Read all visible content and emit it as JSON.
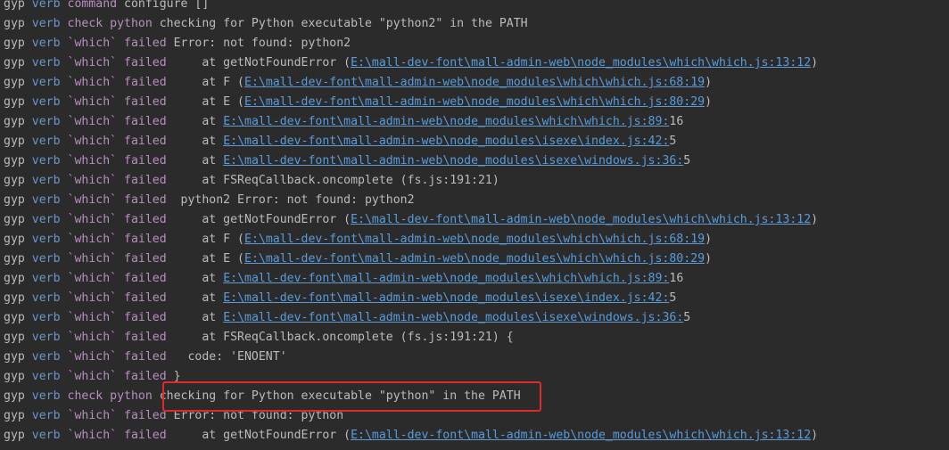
{
  "colors": {
    "background": "#2b2b2b",
    "text": "#bbbbbb",
    "level": "#6a97c8",
    "category": "#b78fbe",
    "link": "#5a9bd8",
    "highlight": "#e02a2a"
  },
  "lines": [
    {
      "tag": "gyp",
      "level": "verb",
      "category": "command",
      "pre": " configure []",
      "link": "",
      "post": ""
    },
    {
      "tag": "gyp",
      "level": "verb",
      "category": "check python",
      "pre": " checking for Python executable \"python2\" in the PATH",
      "link": "",
      "post": ""
    },
    {
      "tag": "gyp",
      "level": "verb",
      "category": "`which` failed",
      "pre": " Error: not found: python2",
      "link": "",
      "post": ""
    },
    {
      "tag": "gyp",
      "level": "verb",
      "category": "`which` failed",
      "pre": "     at getNotFoundError (",
      "link": "E:\\mall-dev-font\\mall-admin-web\\node_modules\\which\\which.js:13:12",
      "post": ")"
    },
    {
      "tag": "gyp",
      "level": "verb",
      "category": "`which` failed",
      "pre": "     at F (",
      "link": "E:\\mall-dev-font\\mall-admin-web\\node_modules\\which\\which.js:68:19",
      "post": ")"
    },
    {
      "tag": "gyp",
      "level": "verb",
      "category": "`which` failed",
      "pre": "     at E (",
      "link": "E:\\mall-dev-font\\mall-admin-web\\node_modules\\which\\which.js:80:29",
      "post": ")"
    },
    {
      "tag": "gyp",
      "level": "verb",
      "category": "`which` failed",
      "pre": "     at ",
      "link": "E:\\mall-dev-font\\mall-admin-web\\node_modules\\which\\which.js:89:",
      "post": "16"
    },
    {
      "tag": "gyp",
      "level": "verb",
      "category": "`which` failed",
      "pre": "     at ",
      "link": "E:\\mall-dev-font\\mall-admin-web\\node_modules\\isexe\\index.js:42:",
      "post": "5"
    },
    {
      "tag": "gyp",
      "level": "verb",
      "category": "`which` failed",
      "pre": "     at ",
      "link": "E:\\mall-dev-font\\mall-admin-web\\node_modules\\isexe\\windows.js:36:",
      "post": "5"
    },
    {
      "tag": "gyp",
      "level": "verb",
      "category": "`which` failed",
      "pre": "     at FSReqCallback.oncomplete (fs.js:191:21)",
      "link": "",
      "post": ""
    },
    {
      "tag": "gyp",
      "level": "verb",
      "category": "`which` failed",
      "pre": "  python2 Error: not found: python2",
      "link": "",
      "post": ""
    },
    {
      "tag": "gyp",
      "level": "verb",
      "category": "`which` failed",
      "pre": "     at getNotFoundError (",
      "link": "E:\\mall-dev-font\\mall-admin-web\\node_modules\\which\\which.js:13:12",
      "post": ")"
    },
    {
      "tag": "gyp",
      "level": "verb",
      "category": "`which` failed",
      "pre": "     at F (",
      "link": "E:\\mall-dev-font\\mall-admin-web\\node_modules\\which\\which.js:68:19",
      "post": ")"
    },
    {
      "tag": "gyp",
      "level": "verb",
      "category": "`which` failed",
      "pre": "     at E (",
      "link": "E:\\mall-dev-font\\mall-admin-web\\node_modules\\which\\which.js:80:29",
      "post": ")"
    },
    {
      "tag": "gyp",
      "level": "verb",
      "category": "`which` failed",
      "pre": "     at ",
      "link": "E:\\mall-dev-font\\mall-admin-web\\node_modules\\which\\which.js:89:",
      "post": "16"
    },
    {
      "tag": "gyp",
      "level": "verb",
      "category": "`which` failed",
      "pre": "     at ",
      "link": "E:\\mall-dev-font\\mall-admin-web\\node_modules\\isexe\\index.js:42:",
      "post": "5"
    },
    {
      "tag": "gyp",
      "level": "verb",
      "category": "`which` failed",
      "pre": "     at ",
      "link": "E:\\mall-dev-font\\mall-admin-web\\node_modules\\isexe\\windows.js:36:",
      "post": "5"
    },
    {
      "tag": "gyp",
      "level": "verb",
      "category": "`which` failed",
      "pre": "     at FSReqCallback.oncomplete (fs.js:191:21) {",
      "link": "",
      "post": ""
    },
    {
      "tag": "gyp",
      "level": "verb",
      "category": "`which` failed",
      "pre": "   code: 'ENOENT'",
      "link": "",
      "post": ""
    },
    {
      "tag": "gyp",
      "level": "verb",
      "category": "`which` failed",
      "pre": " }",
      "link": "",
      "post": ""
    },
    {
      "tag": "gyp",
      "level": "verb",
      "category": "check python",
      "pre": " checking for Python executable \"python\" in the PATH",
      "link": "",
      "post": ""
    },
    {
      "tag": "gyp",
      "level": "verb",
      "category": "`which` failed",
      "pre": " Error: not found: python",
      "link": "",
      "post": ""
    },
    {
      "tag": "gyp",
      "level": "verb",
      "category": "`which` failed",
      "pre": "     at getNotFoundError (",
      "link": "E:\\mall-dev-font\\mall-admin-web\\node_modules\\which\\which.js:13:12",
      "post": ")"
    }
  ]
}
